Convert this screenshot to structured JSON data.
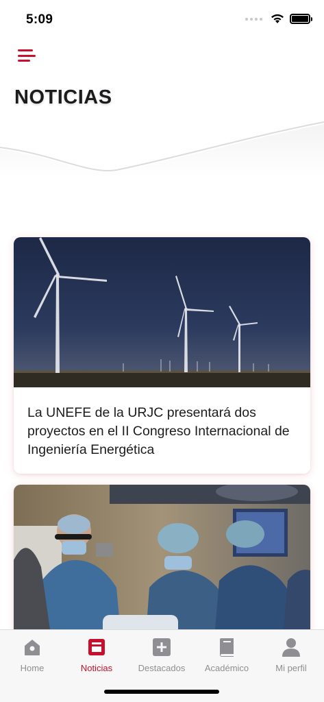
{
  "status_bar": {
    "time": "5:09"
  },
  "header": {
    "title": "NOTICIAS",
    "menu_icon": "menu-icon"
  },
  "news": [
    {
      "title": "La UNEFE de la URJC presentará dos proyectos en el II Congreso Internacional de Ingeniería Energética",
      "image": "wind-turbines-photo"
    },
    {
      "title": "",
      "image": "surgery-photo"
    }
  ],
  "tab_bar": {
    "active": "Noticias",
    "tabs": [
      {
        "label": "Home",
        "icon": "home-icon"
      },
      {
        "label": "Noticias",
        "icon": "news-icon"
      },
      {
        "label": "Destacados",
        "icon": "plus-icon"
      },
      {
        "label": "Académico",
        "icon": "book-icon"
      },
      {
        "label": "Mi perfil",
        "icon": "user-icon"
      }
    ]
  },
  "colors": {
    "accent": "#c8102e",
    "inactive": "#8e8e93"
  }
}
